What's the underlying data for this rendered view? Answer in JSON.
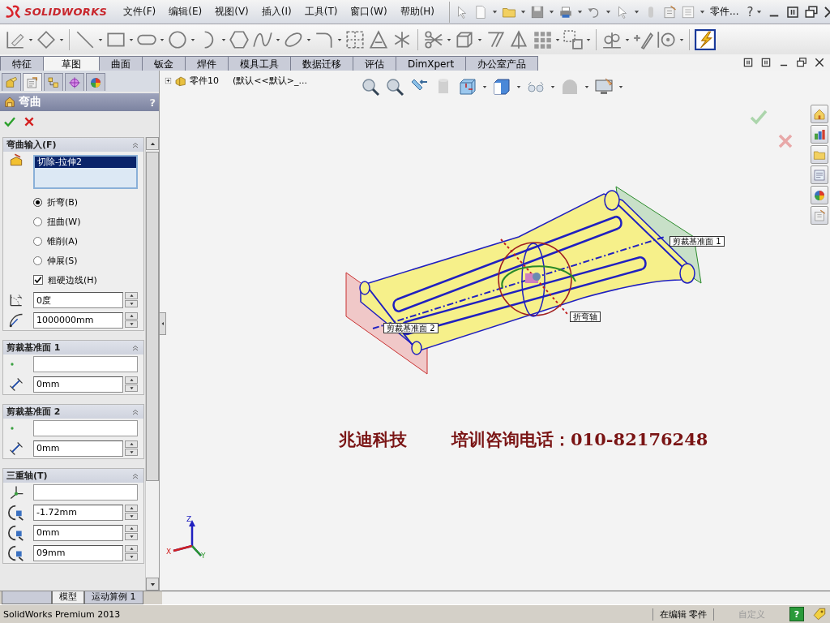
{
  "app": {
    "logo_text": "SOLIDWORKS"
  },
  "menu": [
    "文件(F)",
    "编辑(E)",
    "视图(V)",
    "插入(I)",
    "工具(T)",
    "窗口(W)",
    "帮助(H)"
  ],
  "title_bar": {
    "document": "零件...",
    "help": "?"
  },
  "command_tabs": [
    {
      "label": "特征",
      "selected": false
    },
    {
      "label": "草图",
      "selected": true
    },
    {
      "label": "曲面",
      "selected": false
    },
    {
      "label": "钣金",
      "selected": false
    },
    {
      "label": "焊件",
      "selected": false
    },
    {
      "label": "模具工具",
      "selected": false
    },
    {
      "label": "数据迁移",
      "selected": false
    },
    {
      "label": "评估",
      "selected": false
    },
    {
      "label": "DimXpert",
      "selected": false
    },
    {
      "label": "办公室产品",
      "selected": false
    }
  ],
  "panel_tabs": [
    {
      "selected": false
    },
    {
      "selected": true
    },
    {
      "selected": false
    },
    {
      "selected": false
    },
    {
      "selected": false
    }
  ],
  "property_manager": {
    "title": "弯曲",
    "help": "?",
    "sections": [
      {
        "title": "弯曲输入(F)",
        "rows": [
          {
            "kind": "list",
            "items": [
              {
                "label": "切除-拉伸2",
                "selected": true
              }
            ]
          },
          {
            "kind": "radio",
            "label": "折弯(B)",
            "selected": true
          },
          {
            "kind": "radio",
            "label": "扭曲(W)",
            "selected": false
          },
          {
            "kind": "radio",
            "label": "锥削(A)",
            "selected": false
          },
          {
            "kind": "radio",
            "label": "伸展(S)",
            "selected": false
          },
          {
            "kind": "check",
            "label": "粗硬边线(H)",
            "checked": true
          },
          {
            "kind": "angle",
            "value": "0度"
          },
          {
            "kind": "radius",
            "value": "1000000mm"
          }
        ]
      },
      {
        "title": "剪裁基准面 1",
        "rows": [
          {
            "kind": "select"
          },
          {
            "kind": "distance",
            "value": "0mm"
          }
        ]
      },
      {
        "title": "剪裁基准面 2",
        "rows": [
          {
            "kind": "select"
          },
          {
            "kind": "distance",
            "value": "0mm"
          }
        ]
      },
      {
        "title": "三重轴(T)",
        "rows": [
          {
            "kind": "triad"
          },
          {
            "kind": "x",
            "value": "-1.72mm"
          },
          {
            "kind": "y",
            "value": "0mm"
          },
          {
            "kind": "z",
            "value": "09mm"
          }
        ]
      }
    ]
  },
  "model_tabs": [
    {
      "label": "模型",
      "selected": true
    },
    {
      "label": "运动算例 1",
      "selected": false
    }
  ],
  "viewport": {
    "tree_node": {
      "label": "零件10",
      "config": "(默认<<默认>_..."
    },
    "callouts": [
      "剪裁基准面 1",
      "折弯轴",
      "剪裁基准面 2"
    ],
    "triad": {
      "x": "X",
      "y": "Y",
      "z": "Z"
    },
    "caption": [
      "兆迪科技",
      "培训咨询电话：010-82176248"
    ]
  },
  "status_bar": {
    "product": "SolidWorks Premium 2013",
    "mode": "在编辑 零件",
    "units": "自定义",
    "help": "?"
  }
}
